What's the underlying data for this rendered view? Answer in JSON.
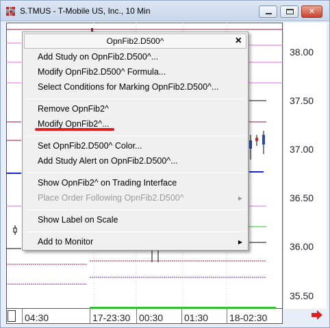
{
  "window": {
    "title": "S.TMUS - T-Mobile US, Inc., 10 Min",
    "icon": "app-logo-icon",
    "controls": {
      "minimize": "minimize-icon",
      "maximize": "maximize-icon",
      "close": "✕"
    }
  },
  "price_scale": {
    "labels": [
      "38.00",
      "37.50",
      "37.00",
      "36.50",
      "36.00",
      "35.50"
    ]
  },
  "time_axis": {
    "labels": [
      "04:30",
      "17-23:30",
      "00:30",
      "01:30",
      "18-02:30"
    ]
  },
  "colors": {
    "accent_red": "#d2232a",
    "fib_line_pink": "#e36ae3",
    "fib_line_maroon": "#9b0f3c",
    "fib_line_purple": "#7a1a9a",
    "fib_line_blue": "#1a22d8",
    "fib_line_green": "#28c228",
    "fib_line_black": "#000000",
    "highlight_underline": "#e02020"
  },
  "context_menu": {
    "header": "OpnFib2.D500^",
    "close": "×",
    "items": [
      {
        "label": "Add Study on OpnFib2.D500^...",
        "enabled": true
      },
      {
        "label": "Modify OpnFib2.D500^ Formula...",
        "enabled": true
      },
      {
        "label": "Select Conditions for Marking OpnFib2.D500^...",
        "enabled": true
      },
      {
        "label": "Remove OpnFib2^",
        "enabled": true
      },
      {
        "label": "Modify OpnFib2^...",
        "enabled": true
      },
      {
        "label": "Set OpnFib2.D500^ Color...",
        "enabled": true
      },
      {
        "label": "Add Study Alert on OpnFib2.D500^...",
        "enabled": true
      },
      {
        "label": "Show OpnFib2^ on Trading Interface",
        "enabled": true
      },
      {
        "label": "Place Order Following OpnFib2.D500^",
        "enabled": false,
        "submenu": true
      },
      {
        "label": "Show Label on Scale",
        "enabled": true
      },
      {
        "label": "Add to Monitor",
        "enabled": true,
        "submenu": true
      }
    ]
  }
}
